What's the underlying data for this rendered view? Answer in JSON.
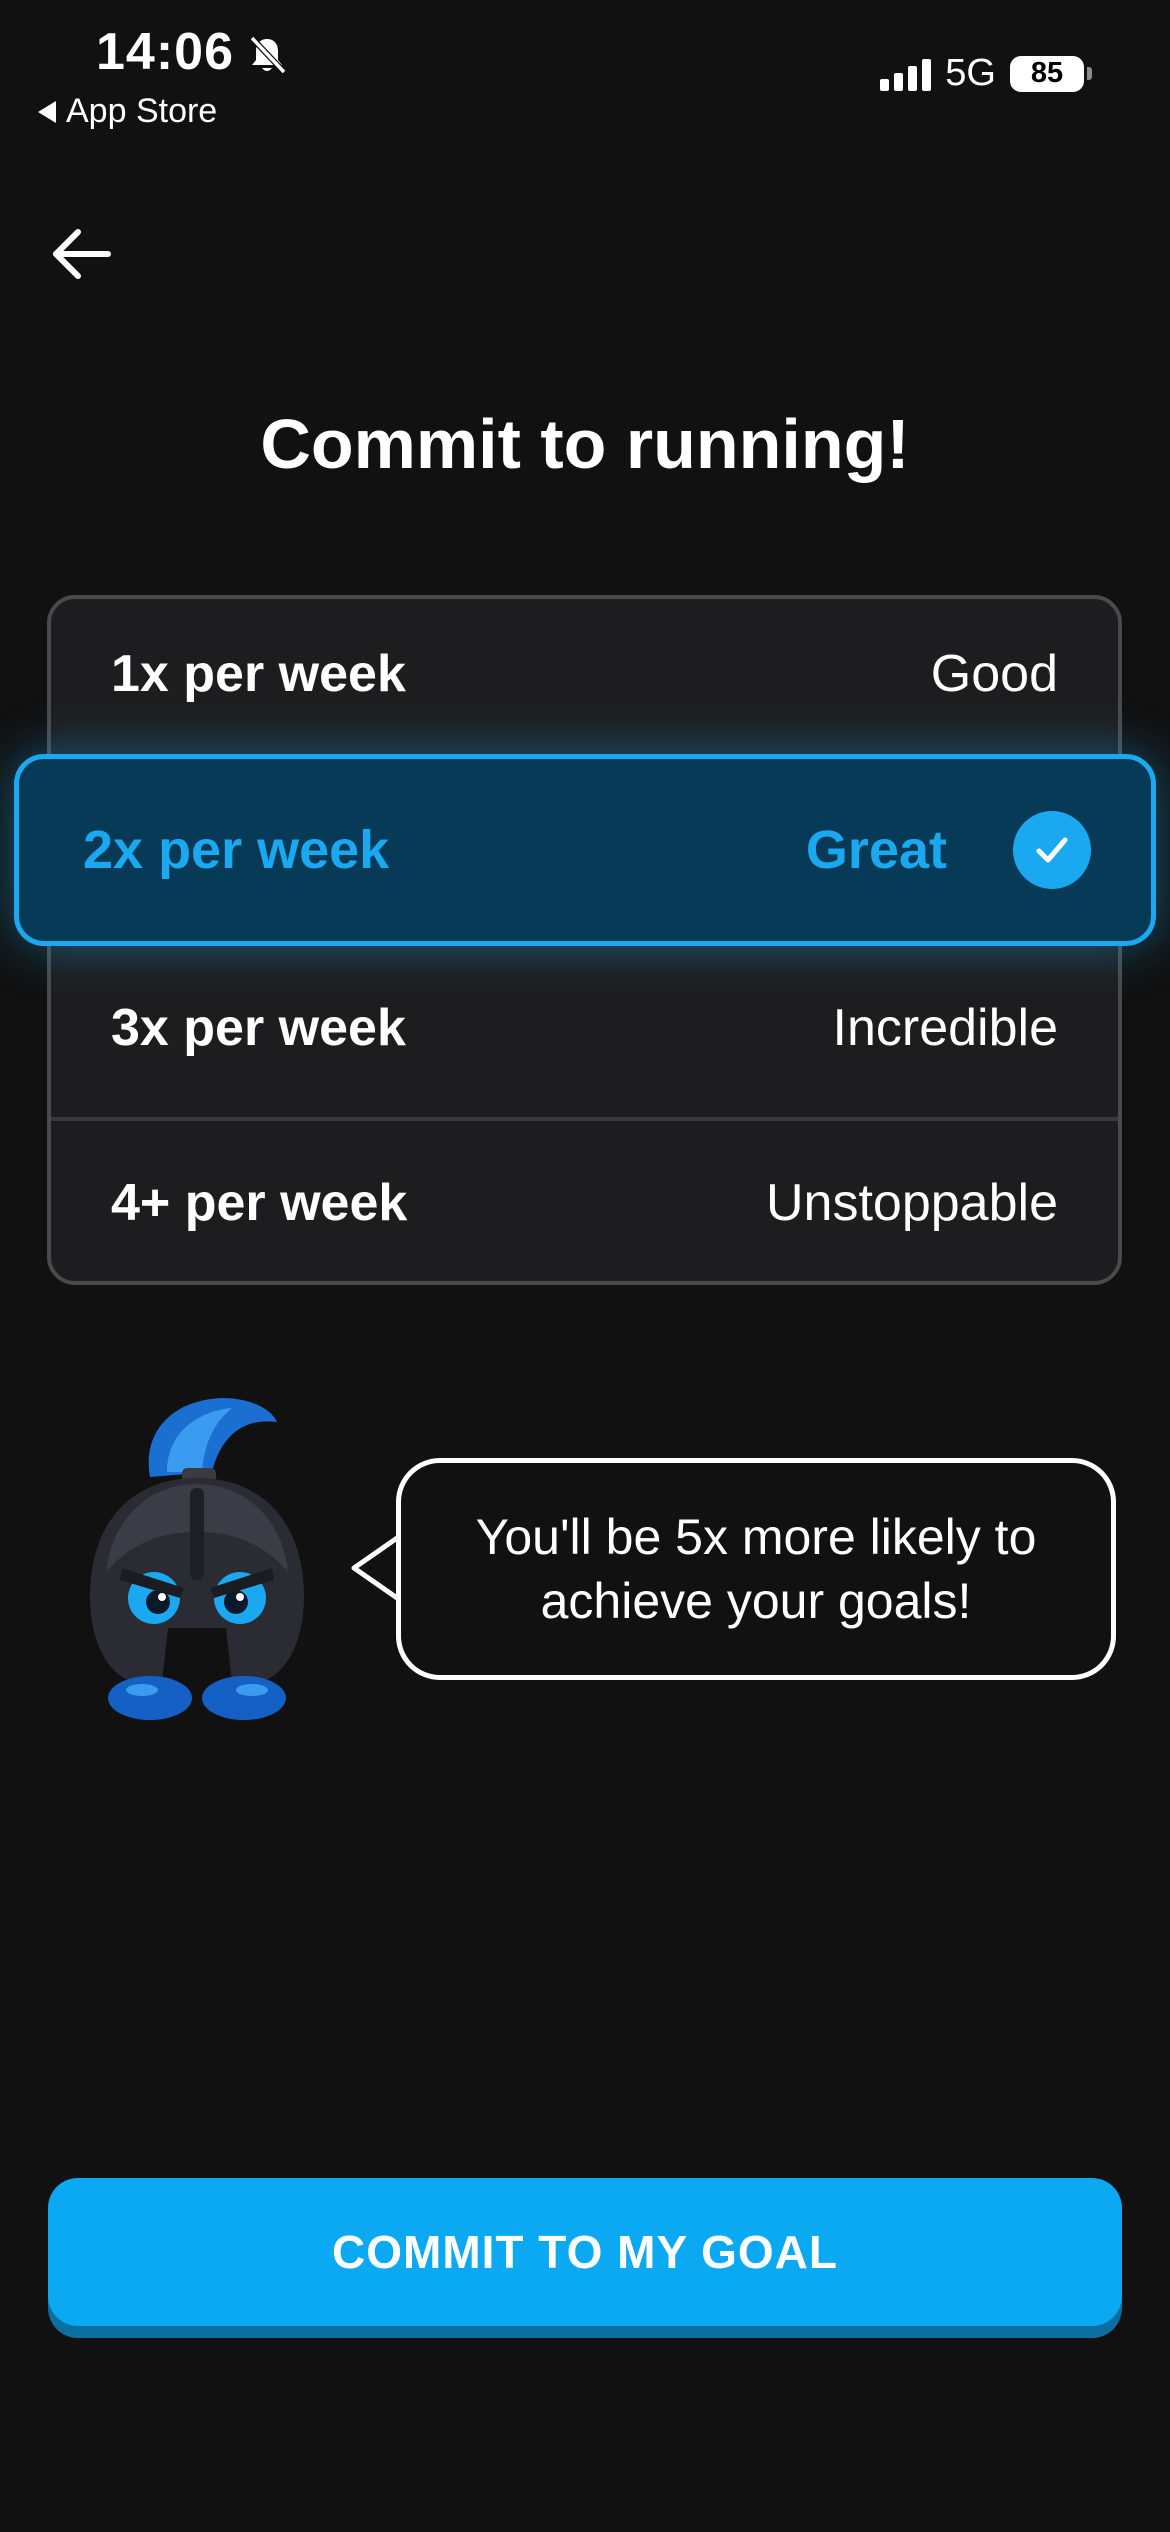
{
  "status_bar": {
    "time": "14:06",
    "back_app_label": "App Store",
    "network": "5G",
    "battery_level": "85"
  },
  "page": {
    "title": "Commit to running!"
  },
  "options": [
    {
      "frequency": "1x per week",
      "rating": "Good",
      "selected": false
    },
    {
      "frequency": "2x per week",
      "rating": "Great",
      "selected": true
    },
    {
      "frequency": "3x per week",
      "rating": "Incredible",
      "selected": false
    },
    {
      "frequency": "4+ per week",
      "rating": "Unstoppable",
      "selected": false
    }
  ],
  "mascot": {
    "speech": "You'll be 5x more likely to achieve your goals!"
  },
  "cta": {
    "label": "COMMIT TO MY GOAL"
  },
  "colors": {
    "background": "#111111",
    "accent": "#1aa9f0",
    "card": "#1d1d1f",
    "button": "#0aa9f2"
  },
  "icons": {
    "status": [
      "bell-muted-icon",
      "back-triangle-icon",
      "signal-icon",
      "battery-icon"
    ],
    "nav": "arrow-left-icon",
    "selection": "check-icon"
  }
}
